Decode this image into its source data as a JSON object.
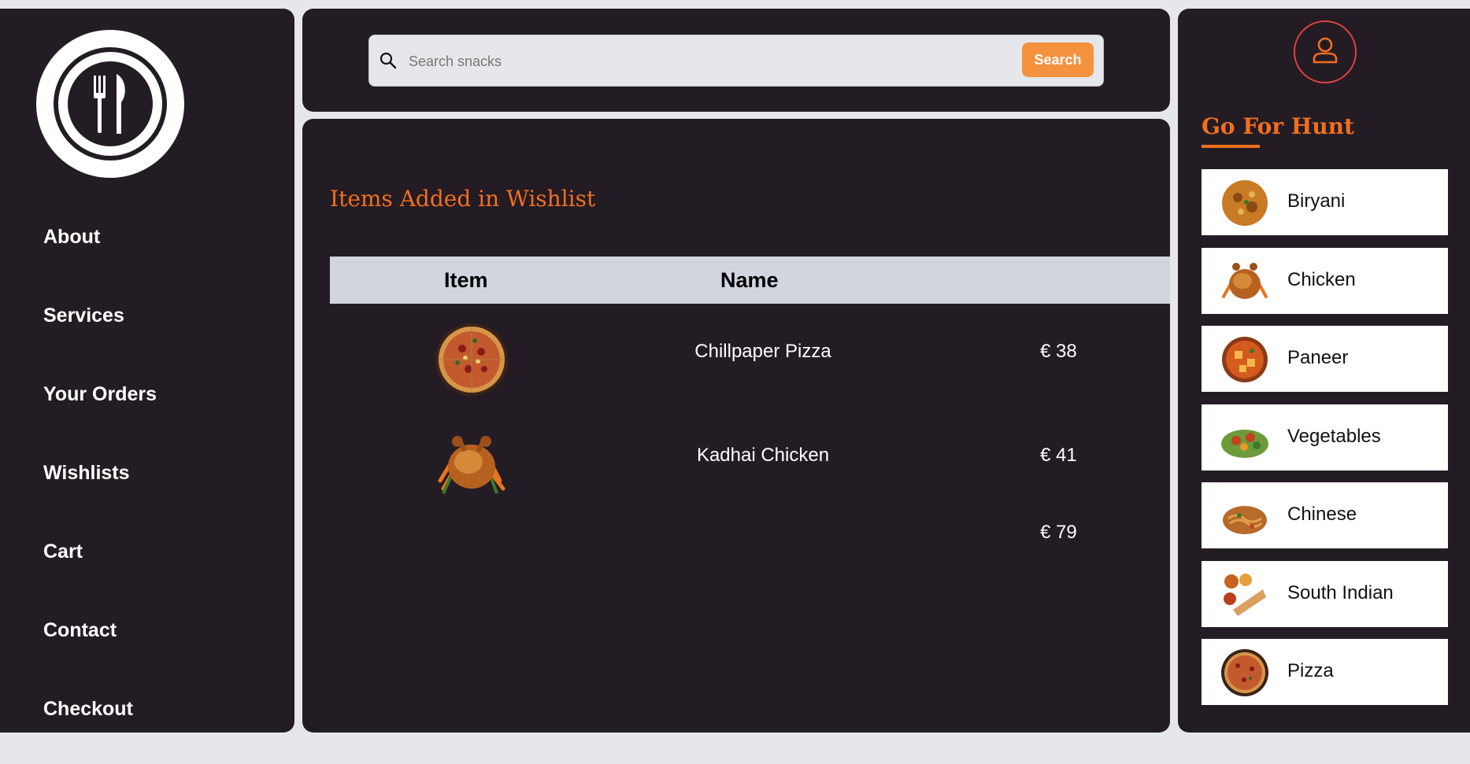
{
  "nav": [
    "About",
    "Services",
    "Your Orders",
    "Wishlists",
    "Cart",
    "Contact",
    "Checkout"
  ],
  "search": {
    "placeholder": "Search snacks",
    "button": "Search"
  },
  "wishlist": {
    "title": "Items Added in Wishlist",
    "columns": [
      "Item",
      "Name"
    ],
    "rows": [
      {
        "name": "Chillpaper Pizza",
        "price": "€ 38",
        "image": "pizza"
      },
      {
        "name": "Kadhai Chicken",
        "price": "€ 41",
        "image": "roast-chicken"
      }
    ],
    "total": "€ 79"
  },
  "hunt": {
    "title": "Go For Hunt",
    "categories": [
      "Biryani",
      "Chicken",
      "Paneer",
      "Vegetables",
      "Chinese",
      "South Indian",
      "Pizza"
    ]
  },
  "colors": {
    "panel": "#241c24",
    "accent": "#f06f1d",
    "button": "#f5923e",
    "background": "#e6e7eb"
  },
  "icons": {
    "logo": "plate-fork-knife-icon",
    "search": "search-icon",
    "user": "user-icon"
  }
}
